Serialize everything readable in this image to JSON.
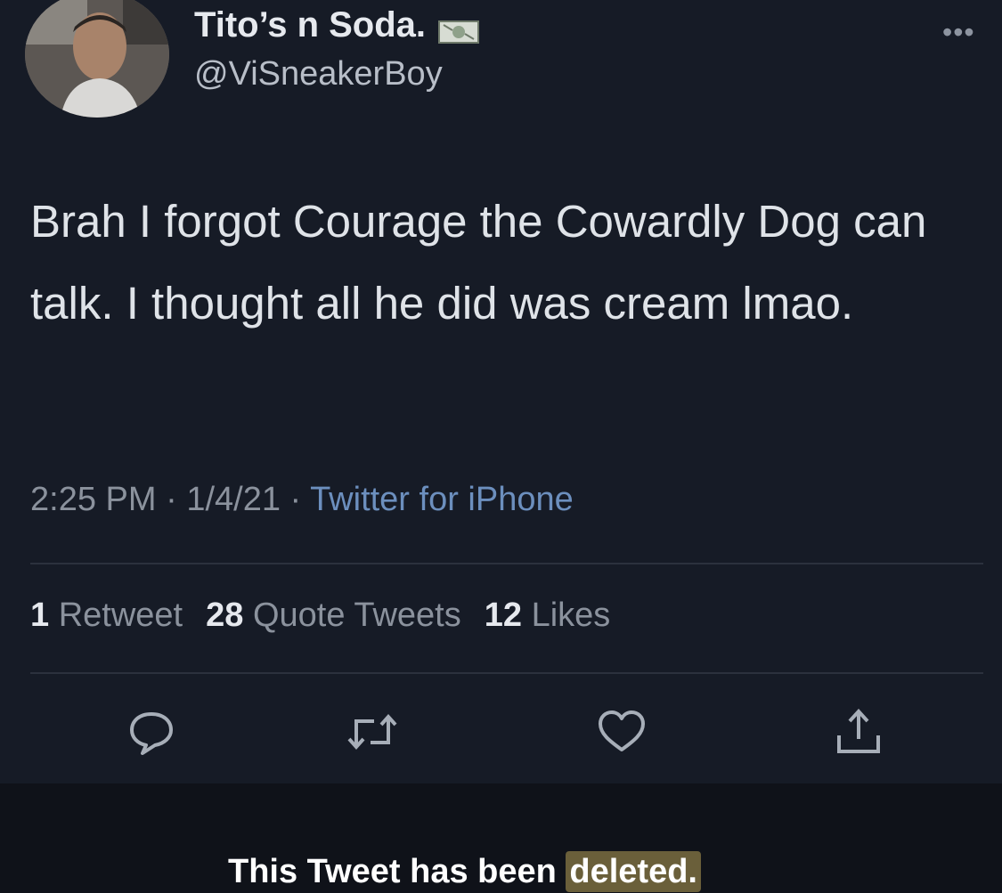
{
  "tweet": {
    "display_name": "Tito’s n Soda.",
    "name_emoji_icon": "money-icon",
    "handle": "@ViSneakerBoy",
    "text": "Brah I forgot Courage the Cowardly Dog can talk. I thought all he did was cream lmao.",
    "time": "2:25 PM",
    "separator": " · ",
    "date": "1/4/21",
    "source": "Twitter for iPhone",
    "stats": {
      "retweets_count": "1",
      "retweets_label": "Retweet",
      "quotes_count": "28",
      "quotes_label": "Quote Tweets",
      "likes_count": "12",
      "likes_label": "Likes"
    },
    "actions": [
      "reply-icon",
      "retweet-icon",
      "like-icon",
      "share-icon"
    ],
    "more_icon": "more-options-icon"
  },
  "overlay": {
    "message_prefix": "This Tweet has been ",
    "message_highlight": "deleted."
  },
  "colors": {
    "background": "#161b26",
    "link": "#6c8fbe",
    "highlight": "#6a5f3a"
  }
}
